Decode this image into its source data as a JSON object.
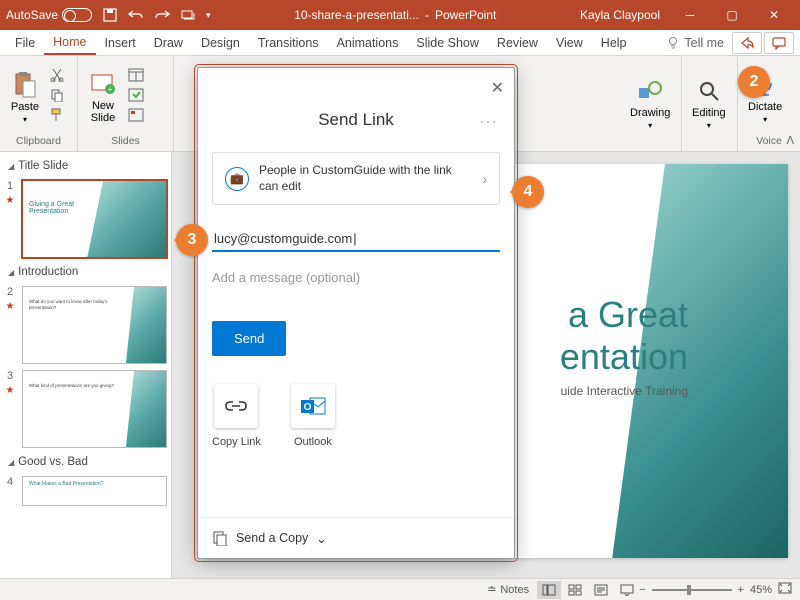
{
  "titlebar": {
    "autosave": "AutoSave",
    "filename": "10-share-a-presentati...",
    "app": "PowerPoint",
    "user": "Kayla Claypool"
  },
  "tabs": {
    "file": "File",
    "home": "Home",
    "insert": "Insert",
    "draw": "Draw",
    "design": "Design",
    "transitions": "Transitions",
    "animations": "Animations",
    "slideshow": "Slide Show",
    "review": "Review",
    "view": "View",
    "help": "Help",
    "tellme": "Tell me"
  },
  "ribbon": {
    "clipboard": {
      "label": "Clipboard",
      "paste": "Paste"
    },
    "slides": {
      "label": "Slides",
      "newslide": "New\nSlide"
    },
    "drawing": {
      "label": "Drawing"
    },
    "editing": {
      "label": "Editing"
    },
    "voice": {
      "label": "Voice",
      "dictate": "Dictate"
    }
  },
  "sections": [
    {
      "title": "Title Slide",
      "slides": [
        {
          "num": "1",
          "title": "Giving a Great\nPresentation",
          "selected": true
        }
      ]
    },
    {
      "title": "Introduction",
      "slides": [
        {
          "num": "2",
          "text": "What do you want to know after today's presentation?"
        },
        {
          "num": "3",
          "text": "What kind of presentations are you giving?"
        }
      ]
    },
    {
      "title": "Good vs. Bad",
      "slides": [
        {
          "num": "4",
          "title": "What Makes a Bad Presentation?"
        }
      ]
    }
  ],
  "canvas": {
    "title": "a Great\nentation",
    "sub": "uide Interactive Training"
  },
  "dialog": {
    "title": "Send Link",
    "link_settings": "People in CustomGuide with the link can edit",
    "email": "lucy@customguide.com",
    "msg_placeholder": "Add a message (optional)",
    "send": "Send",
    "copy_link": "Copy Link",
    "outlook": "Outlook",
    "send_copy": "Send a Copy"
  },
  "statusbar": {
    "notes": "Notes",
    "zoom": "45%"
  },
  "badges": {
    "b2": "2",
    "b3": "3",
    "b4": "4"
  }
}
